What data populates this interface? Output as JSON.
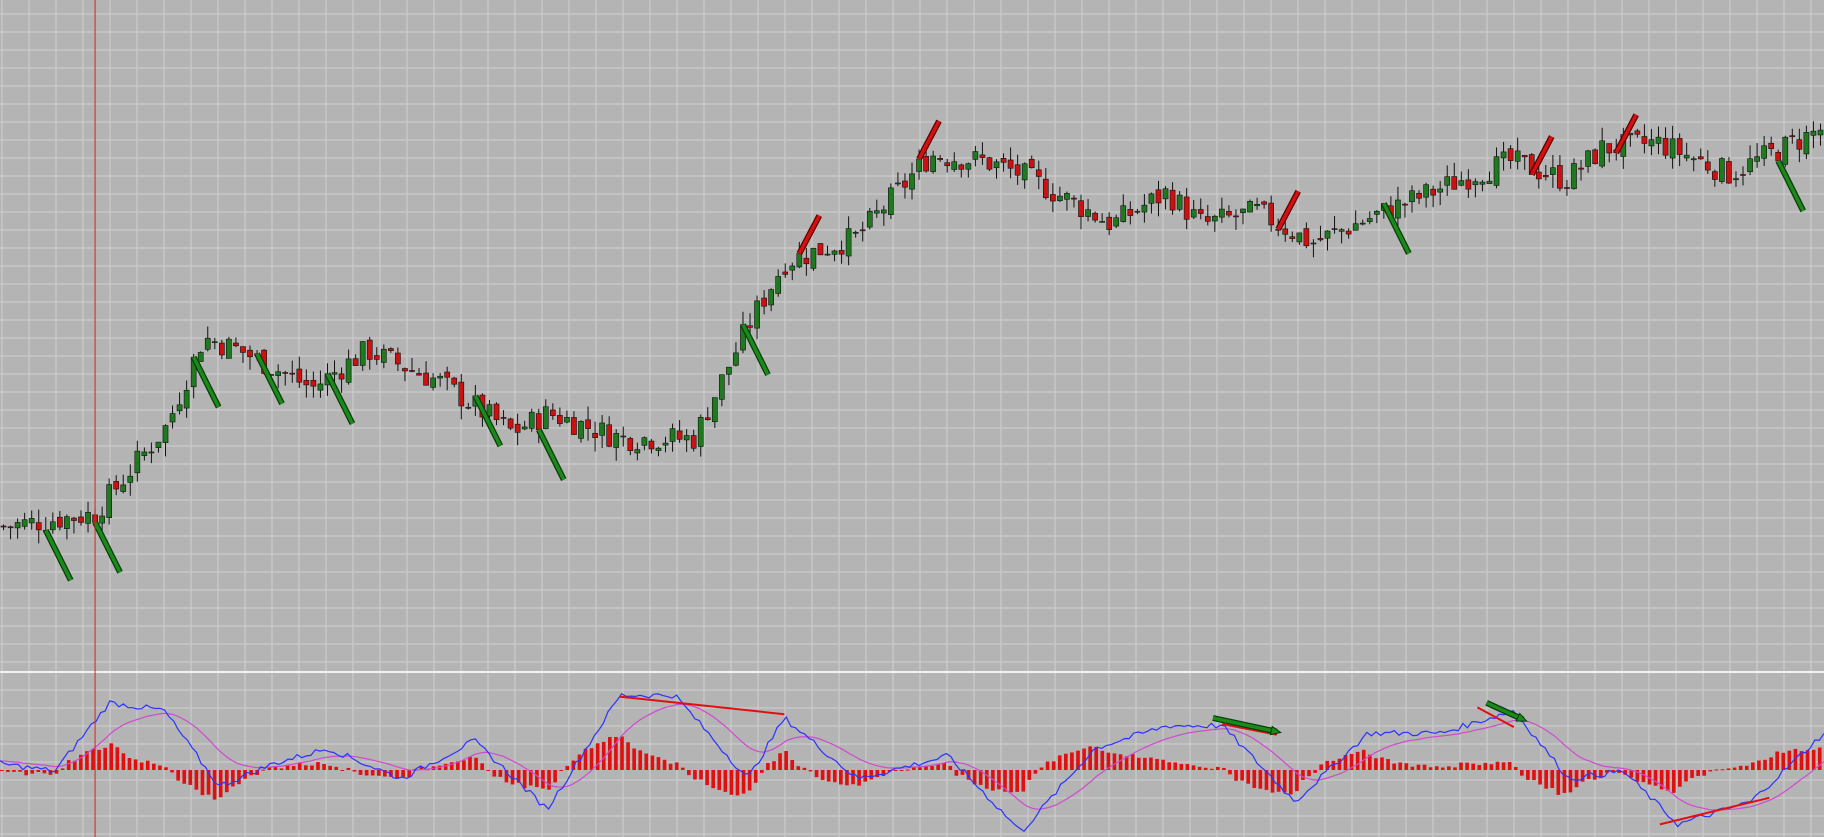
{
  "chart_data": {
    "type": "candlestick",
    "grid": true,
    "colors": {
      "background": "#b4b4b4",
      "grid": "#cfcfcf",
      "bull": "#1f7a1f",
      "bear": "#cc1111",
      "wick": "#111111",
      "signal_up": "#1a8a1a",
      "signal_down": "#d41010",
      "cursor_line": "#e02020",
      "pane_separator": "#f2f2f2",
      "macd_line": "#2b33ff",
      "signal_line": "#d04ad0",
      "histogram": "#e01010",
      "divergence_line": "#e01010"
    },
    "price_pane": {
      "y_range": [
        0,
        100
      ],
      "close_path": [
        [
          0,
          18
        ],
        [
          5,
          20
        ],
        [
          9,
          34
        ],
        [
          11,
          48
        ],
        [
          13,
          46
        ],
        [
          17,
          40
        ],
        [
          20,
          46
        ],
        [
          24,
          41
        ],
        [
          28,
          33
        ],
        [
          30,
          36
        ],
        [
          34,
          32
        ],
        [
          38,
          32
        ],
        [
          41,
          50
        ],
        [
          43,
          60
        ],
        [
          47,
          64
        ],
        [
          51,
          77
        ],
        [
          54,
          76
        ],
        [
          56,
          74
        ],
        [
          61,
          66
        ],
        [
          64,
          71
        ],
        [
          66,
          66
        ],
        [
          69,
          68
        ],
        [
          72,
          63
        ],
        [
          76,
          68
        ],
        [
          81,
          74
        ],
        [
          83,
          76
        ],
        [
          86,
          73
        ],
        [
          88,
          78
        ],
        [
          91,
          79
        ],
        [
          95,
          74
        ],
        [
          100,
          81
        ]
      ],
      "candles": 259,
      "seed": 7,
      "signals": [
        {
          "dir": "down",
          "i": 6
        },
        {
          "dir": "down",
          "i": 13
        },
        {
          "dir": "down",
          "i": 27
        },
        {
          "dir": "down",
          "i": 36
        },
        {
          "dir": "down",
          "i": 46
        },
        {
          "dir": "down",
          "i": 67
        },
        {
          "dir": "down",
          "i": 76
        },
        {
          "dir": "down",
          "i": 105
        },
        {
          "dir": "up",
          "i": 113
        },
        {
          "dir": "up",
          "i": 130
        },
        {
          "dir": "up",
          "i": 181
        },
        {
          "dir": "down",
          "i": 196
        },
        {
          "dir": "up",
          "i": 217
        },
        {
          "dir": "up",
          "i": 229
        },
        {
          "dir": "down",
          "i": 252
        }
      ],
      "cursor_index": 13
    },
    "oscillator_pane": {
      "y_range": [
        -1,
        1
      ],
      "macd_path": [
        [
          0,
          -0.1
        ],
        [
          3,
          -0.2
        ],
        [
          6,
          0.7
        ],
        [
          9,
          0.6
        ],
        [
          12,
          -0.4
        ],
        [
          15,
          -0.1
        ],
        [
          18,
          0.1
        ],
        [
          22,
          -0.3
        ],
        [
          26,
          0.2
        ],
        [
          30,
          -0.7
        ],
        [
          34,
          0.8
        ],
        [
          37,
          0.8
        ],
        [
          41,
          -0.3
        ],
        [
          43,
          0.5
        ],
        [
          47,
          -0.3
        ],
        [
          52,
          0.0
        ],
        [
          56,
          -1.0
        ],
        [
          60,
          0.1
        ],
        [
          64,
          0.4
        ],
        [
          67,
          0.4
        ],
        [
          71,
          -0.6
        ],
        [
          75,
          0.3
        ],
        [
          79,
          0.3
        ],
        [
          83,
          0.6
        ],
        [
          86,
          -0.3
        ],
        [
          89,
          -0.2
        ],
        [
          92,
          -0.9
        ],
        [
          96,
          -0.6
        ],
        [
          100,
          0.3
        ]
      ],
      "divergences": [
        {
          "color": "red",
          "from": [
            34,
            0.78
          ],
          "to": [
            43,
            0.55
          ]
        },
        {
          "color": "red",
          "from": [
            67,
            0.42
          ],
          "to": [
            70,
            0.28
          ]
        },
        {
          "color": "red",
          "from": [
            81,
            0.64
          ],
          "to": [
            83,
            0.38
          ]
        },
        {
          "color": "red",
          "from": [
            91,
            -0.9
          ],
          "to": [
            97,
            -0.55
          ]
        }
      ],
      "divergence_arrows": [
        {
          "from": [
            66.5,
            0.5
          ],
          "to": [
            70,
            0.32
          ]
        },
        {
          "from": [
            81.5,
            0.7
          ],
          "to": [
            83.5,
            0.48
          ]
        }
      ]
    }
  }
}
